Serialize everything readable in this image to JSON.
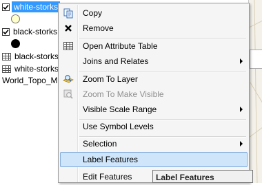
{
  "toc": {
    "layers": [
      {
        "name": "white-storks",
        "checked": true,
        "selected": true
      },
      {
        "name": "black-storks",
        "checked": true,
        "selected": false
      },
      {
        "name": "black-storks",
        "type": "table"
      },
      {
        "name": "white-storks",
        "type": "table"
      },
      {
        "name": "World_Topo_M"
      }
    ]
  },
  "colors": {
    "selection": "#3399ff",
    "hover": "#cfe5fa",
    "white_stork_symbol": "#ffffcc",
    "black_stork_symbol": "#000000"
  },
  "menu": {
    "items": [
      {
        "label": "Copy",
        "icon": "copy-icon"
      },
      {
        "label": "Remove",
        "icon": "remove-icon"
      },
      {
        "label": "Open Attribute Table",
        "icon": "table-icon"
      },
      {
        "label": "Joins and Relates",
        "submenu": true
      },
      {
        "label": "Zoom To Layer",
        "icon": "zoom-to-layer-icon"
      },
      {
        "label": "Zoom To Make Visible",
        "icon": "zoom-visible-icon",
        "disabled": true
      },
      {
        "label": "Visible Scale Range",
        "submenu": true
      },
      {
        "label": "Use Symbol Levels"
      },
      {
        "label": "Selection",
        "submenu": true
      },
      {
        "label": "Label Features",
        "highlighted": true
      },
      {
        "label": "Edit Features",
        "submenu": true
      }
    ]
  },
  "tooltip": {
    "text": "Label Features"
  }
}
